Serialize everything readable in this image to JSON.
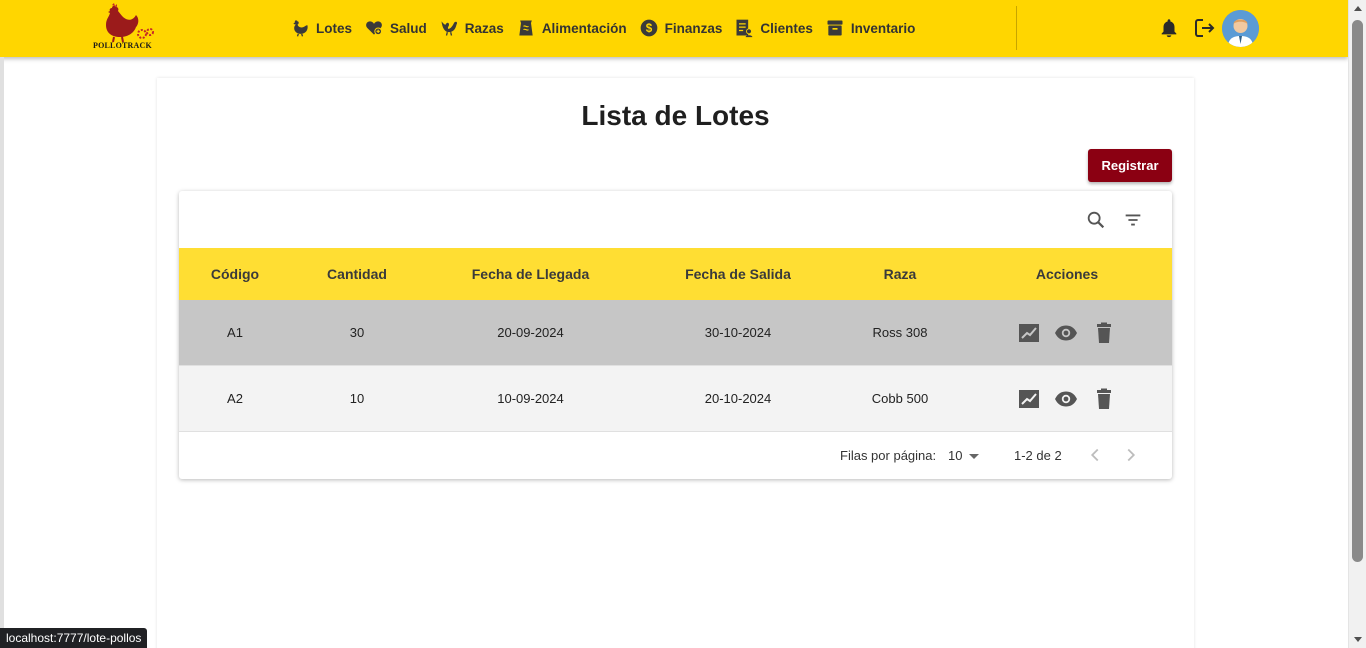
{
  "brand": {
    "logo_text": "POLLOTRACK"
  },
  "nav": {
    "items": [
      {
        "label": "Lotes",
        "icon": "chicken-icon"
      },
      {
        "label": "Salud",
        "icon": "health-heart-icon"
      },
      {
        "label": "Razas",
        "icon": "rooster-icon"
      },
      {
        "label": "Alimentación",
        "icon": "feed-bag-icon"
      },
      {
        "label": "Finanzas",
        "icon": "dollar-icon"
      },
      {
        "label": "Clientes",
        "icon": "clients-doc-icon"
      },
      {
        "label": "Inventario",
        "icon": "archive-box-icon"
      }
    ]
  },
  "header_actions": {
    "notifications_icon": "bell-icon",
    "logout_icon": "logout-icon",
    "avatar_icon": "user-avatar"
  },
  "main": {
    "title": "Lista de Lotes",
    "register_label": "Registrar"
  },
  "table": {
    "toolbar": {
      "search_icon": "search-icon",
      "filter_icon": "filter-icon"
    },
    "columns": [
      "Código",
      "Cantidad",
      "Fecha de Llegada",
      "Fecha de Salida",
      "Raza",
      "Acciones"
    ],
    "rows": [
      {
        "codigo": "A1",
        "cantidad": "30",
        "llegada": "20-09-2024",
        "salida": "30-10-2024",
        "raza": "Ross 308"
      },
      {
        "codigo": "A2",
        "cantidad": "10",
        "llegada": "10-09-2024",
        "salida": "20-10-2024",
        "raza": "Cobb 500"
      }
    ],
    "row_actions": [
      "trending-chart-icon",
      "eye-icon",
      "trash-icon"
    ],
    "pagination": {
      "rows_per_page_label": "Filas por página:",
      "rows_per_page": "10",
      "range": "1-2 de 2"
    }
  },
  "status_url": "localhost:7777/lote-pollos",
  "colors": {
    "header_bg": "#FFD600",
    "table_header_bg": "#FFDE33",
    "primary_button": "#8B0012",
    "selected_row": "#c6c6c6"
  }
}
